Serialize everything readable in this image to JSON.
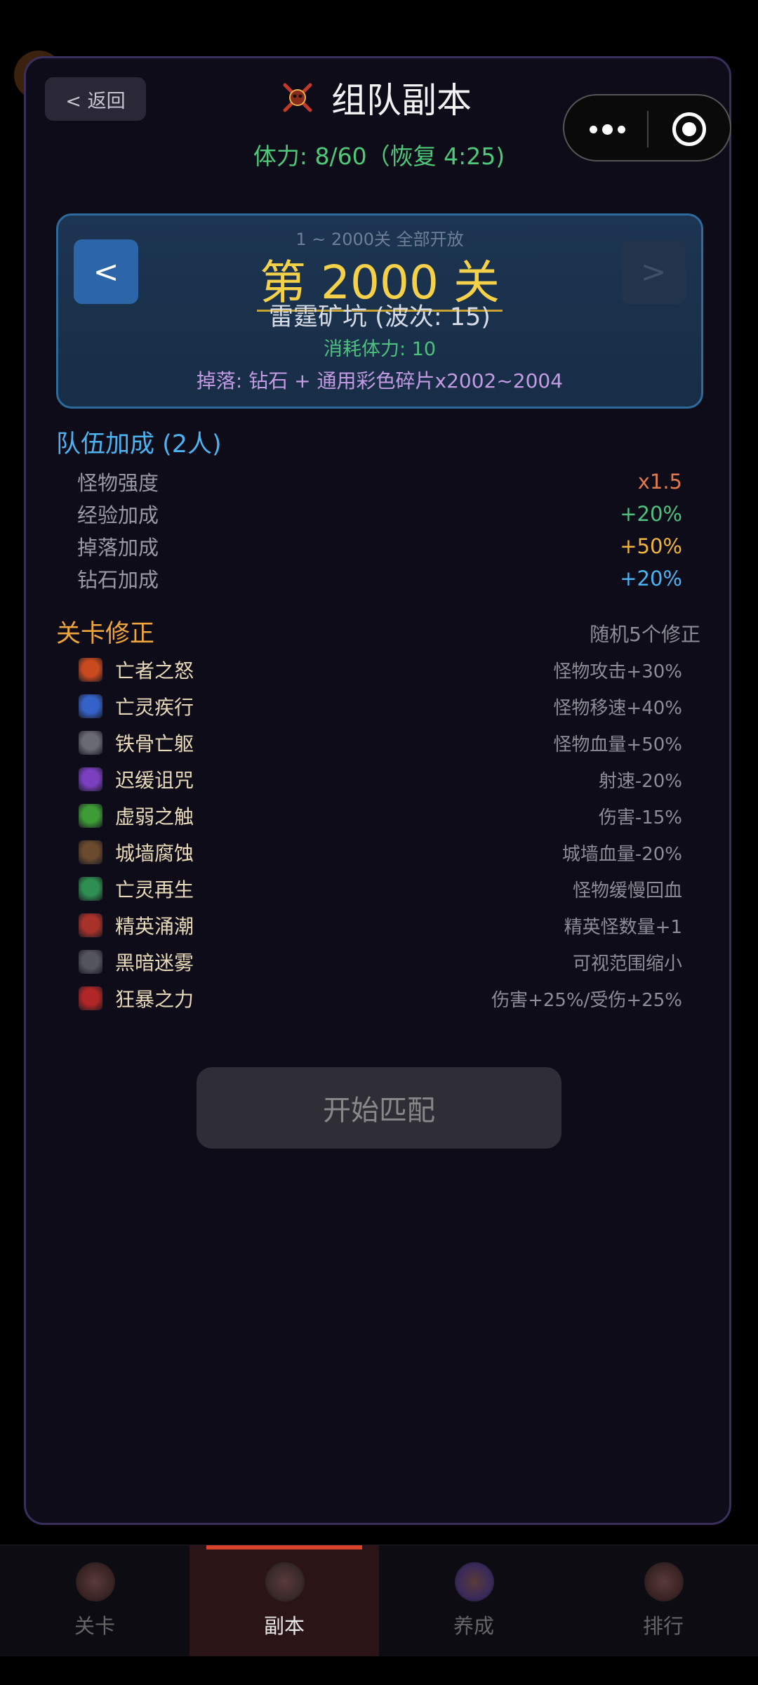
{
  "header": {
    "back_label": "< 返回",
    "title": "组队副本",
    "stamina": "体力: 8/60（恢复 4:25)"
  },
  "stage": {
    "range_note": "1 ~ 2000关 全部开放",
    "prev_label": "<",
    "next_label": ">",
    "number_label": "第 2000 关",
    "name": "雷霆矿坑 (波次: 15)",
    "cost": "消耗体力: 10",
    "drop": "掉落: 钻石 + 通用彩色碎片x2002~2004"
  },
  "team_bonus": {
    "title": "队伍加成 (2人)",
    "rows": [
      {
        "label": "怪物强度",
        "value": "x1.5",
        "color": "#e07a4e"
      },
      {
        "label": "经验加成",
        "value": "+20%",
        "color": "#4fc07e"
      },
      {
        "label": "掉落加成",
        "value": "+50%",
        "color": "#f0b43c"
      },
      {
        "label": "钻石加成",
        "value": "+20%",
        "color": "#4db2f0"
      }
    ]
  },
  "modifiers": {
    "title": "关卡修正",
    "note": "随机5个修正",
    "items": [
      {
        "name": "亡者之怒",
        "effect": "怪物攻击+30%",
        "icon": "flame-skull-icon",
        "color": "#c84a1e"
      },
      {
        "name": "亡灵疾行",
        "effect": "怪物移速+40%",
        "icon": "lightning-icon",
        "color": "#3462c9"
      },
      {
        "name": "铁骨亡躯",
        "effect": "怪物血量+50%",
        "icon": "shield-icon",
        "color": "#6a6a72"
      },
      {
        "name": "迟缓诅咒",
        "effect": "射速-20%",
        "icon": "curse-orb-icon",
        "color": "#7b3fc0"
      },
      {
        "name": "虚弱之触",
        "effect": "伤害-15%",
        "icon": "green-hand-icon",
        "color": "#3d9c36"
      },
      {
        "name": "城墙腐蚀",
        "effect": "城墙血量-20%",
        "icon": "rot-wall-icon",
        "color": "#6b4a2e"
      },
      {
        "name": "亡灵再生",
        "effect": "怪物缓慢回血",
        "icon": "heal-icon",
        "color": "#2f8f52"
      },
      {
        "name": "精英涌潮",
        "effect": "精英怪数量+1",
        "icon": "elite-skull-icon",
        "color": "#a8322a"
      },
      {
        "name": "黑暗迷雾",
        "effect": "可视范围缩小",
        "icon": "fog-icon",
        "color": "#55555f"
      },
      {
        "name": "狂暴之力",
        "effect": "伤害+25%/受伤+25%",
        "icon": "rage-icon",
        "color": "#b12626"
      }
    ]
  },
  "start_label": "开始匹配",
  "tabs": [
    {
      "label": "关卡",
      "active": false
    },
    {
      "label": "副本",
      "active": true
    },
    {
      "label": "养成",
      "active": false
    },
    {
      "label": "排行",
      "active": false
    }
  ]
}
